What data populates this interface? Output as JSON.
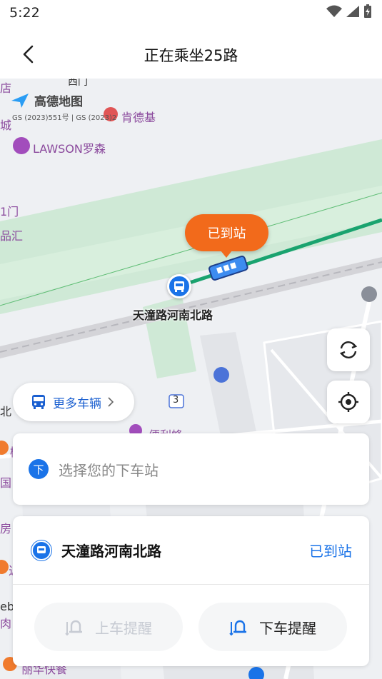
{
  "status_bar": {
    "time": "5:22"
  },
  "header": {
    "title": "正在乘坐25路"
  },
  "map": {
    "logo_text": "高德地图",
    "license_text": "GS (2023)551号 | GS (2023)2",
    "labels": {
      "top_cut": "西门",
      "left_1": "店",
      "left_2": "城",
      "lawson": "LAWSON罗森",
      "kfc_cut": "肯德基",
      "gate_1": "1门",
      "pinhui": "品汇",
      "north": "北",
      "left_guo": "国",
      "left_fang": "房",
      "left_rou": "肉",
      "left_eb": "eb",
      "convenience": "便利蜂",
      "left_mu": "椒",
      "bottom_cut": "丽华快餐",
      "road_number": "3",
      "left_jin": "近"
    },
    "bubble_text": "已到站",
    "stop_label": "天潼路河南北路"
  },
  "more_vehicles": {
    "label": "更多车辆"
  },
  "destination": {
    "badge": "下",
    "placeholder": "选择您的下车站"
  },
  "current_stop": {
    "name": "天潼路河南北路",
    "status": "已到站"
  },
  "reminders": {
    "board_label": "上车提醒",
    "alight_label": "下车提醒"
  },
  "colors": {
    "accent": "#1a73e8",
    "bubble": "#f26a1b",
    "route": "#1aa36f"
  }
}
